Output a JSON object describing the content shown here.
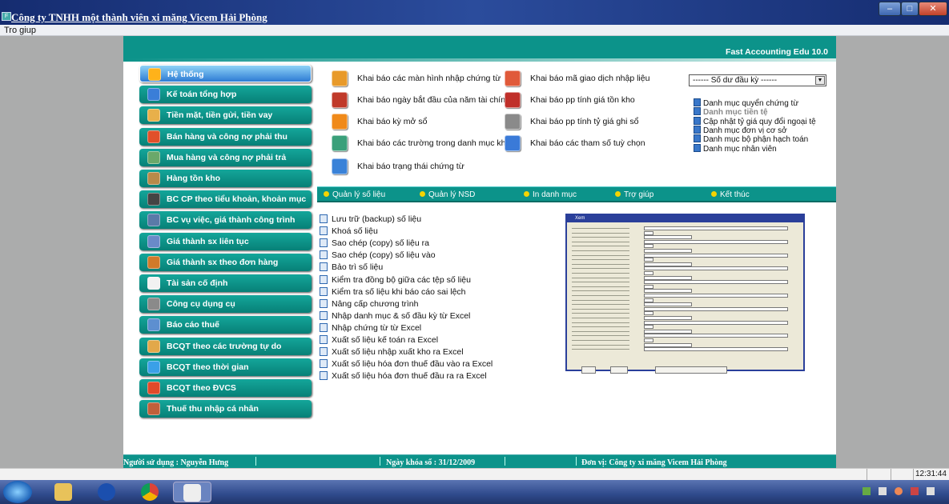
{
  "window": {
    "title": "Công ty TNHH một thành viên xi măng Vicem Hải Phòng",
    "buttons": [
      "–",
      "□",
      "✕"
    ]
  },
  "menu": {
    "help": "Tro giup"
  },
  "header": {
    "product": "Fast Accounting Edu 10.0"
  },
  "nav": [
    {
      "label": "Hệ thống",
      "icon": "gear-icon",
      "color": "#ffb21a",
      "active": true
    },
    {
      "label": "Kế toán tổng hợp",
      "icon": "ledger-icon",
      "color": "#3a7ed8"
    },
    {
      "label": "Tiền mặt, tiền gửi, tiền vay",
      "icon": "bank-icon",
      "color": "#e8b04a"
    },
    {
      "label": "Bán hàng và công nợ phải thu",
      "icon": "truck-icon",
      "color": "#e0502a"
    },
    {
      "label": "Mua hàng và công nợ phải trả",
      "icon": "cart-icon",
      "color": "#6aa86a"
    },
    {
      "label": "Hàng tồn kho",
      "icon": "warehouse-icon",
      "color": "#b78a4a"
    },
    {
      "label": "BC CP theo tiểu khoản, khoản mục",
      "icon": "report-icon",
      "color": "#444"
    },
    {
      "label": "BC vụ việc, giá thành công trình",
      "icon": "chart-icon",
      "color": "#5a7aa8"
    },
    {
      "label": "Giá thành sx liên tục",
      "icon": "coins-icon",
      "color": "#6a8ac8"
    },
    {
      "label": "Giá thành sx theo đơn hàng",
      "icon": "truck-icon",
      "color": "#d07a2a"
    },
    {
      "label": "Tài sản cố định",
      "icon": "house-icon",
      "color": "#f2f2f2"
    },
    {
      "label": "Công cụ dụng cụ",
      "icon": "tools-icon",
      "color": "#8a8a8a"
    },
    {
      "label": "Báo cáo thuế",
      "icon": "tax-icon",
      "color": "#5d8fd0"
    },
    {
      "label": "BCQT theo các trường tự do",
      "icon": "people-icon",
      "color": "#e2a84a"
    },
    {
      "label": "BCQT theo thời gian",
      "icon": "clock-icon",
      "color": "#3aa0e8"
    },
    {
      "label": "BCQT theo ĐVCS",
      "icon": "arrow-icon",
      "color": "#e04a2a"
    },
    {
      "label": "Thuế thu nhập cá nhân",
      "icon": "person-icon",
      "color": "#c0603a"
    }
  ],
  "options_left": [
    {
      "label": "Khai báo các màn hình nhập chứng từ",
      "icon": "pencil-icon",
      "color": "#e89a2a"
    },
    {
      "label": "Khai báo ngày bắt đầu của năm tài chính",
      "icon": "calendar-icon",
      "color": "#c03a2a"
    },
    {
      "label": "Khai báo kỳ mở sổ",
      "icon": "marker-icon",
      "color": "#f08a1a"
    },
    {
      "label": "Khai báo các trường trong danh mục khi ti",
      "icon": "magnifier-icon",
      "color": "#3aa07a"
    },
    {
      "label": "Khai báo trạng thái chứng từ",
      "icon": "windows-icon",
      "color": "#3a82d8"
    }
  ],
  "options_right": [
    {
      "label": "Khai báo mã giao dịch nhập liệu",
      "icon": "notepad-icon",
      "color": "#e05a3a"
    },
    {
      "label": "Khai báo pp tính giá tồn kho",
      "icon": "box-icon",
      "color": "#c0302a"
    },
    {
      "label": "Khai báo pp tính tỷ giá ghi sổ",
      "icon": "calculator-icon",
      "color": "#8a8a8a"
    },
    {
      "label": "Khai báo các tham số tuỳ chọn",
      "icon": "gears-icon",
      "color": "#3a7ad8"
    }
  ],
  "combo": {
    "value": "------ Số dư đầu kỳ ------"
  },
  "catalog_links": [
    {
      "label": "Danh mục quyển chứng từ",
      "disabled": false
    },
    {
      "label": "Danh mục tiền tệ",
      "disabled": true
    },
    {
      "label": "Cập nhật tỷ giá quy đổi ngoại tệ",
      "disabled": false
    },
    {
      "label": "Danh mục đơn vị cơ sở",
      "disabled": false
    },
    {
      "label": "Danh mục bộ phận hạch toán",
      "disabled": false
    },
    {
      "label": "Danh mục nhân viên",
      "disabled": false
    }
  ],
  "submenu": [
    "Quản lý số liệu",
    "Quản lý NSD",
    "In danh mục",
    "Trợ giúp",
    "Kết thúc"
  ],
  "tools": [
    "Lưu trữ (backup) số liệu",
    "Khoá số liệu",
    "Sao chép (copy) số liệu ra",
    "Sao chép (copy) số liệu vào",
    "Bảo trì số liệu",
    "Kiểm tra đồng bộ giữa các tệp số liệu",
    "Kiểm tra số liệu khi báo cáo sai lệch",
    "Nâng cấp chương trình",
    "Nhập danh mục & số đầu kỳ từ Excel",
    "Nhập chứng từ từ Excel",
    "Xuất số liệu kế toán ra Excel",
    "Xuất số liệu nhập xuất kho ra Excel",
    "Xuất số liệu hóa đơn thuế đầu vào ra Excel",
    "Xuất số liệu hóa đơn thuế đầu ra ra Excel"
  ],
  "preview": {
    "title": "Xem"
  },
  "status": {
    "user": "Người sử dụng : Nguyễn Hưng",
    "lock_date": "Ngày khóa sổ : 31/12/2009",
    "unit": "Đơn vị: Công ty xi măng Vicem Hải Phòng"
  },
  "clock": "12:31:44"
}
